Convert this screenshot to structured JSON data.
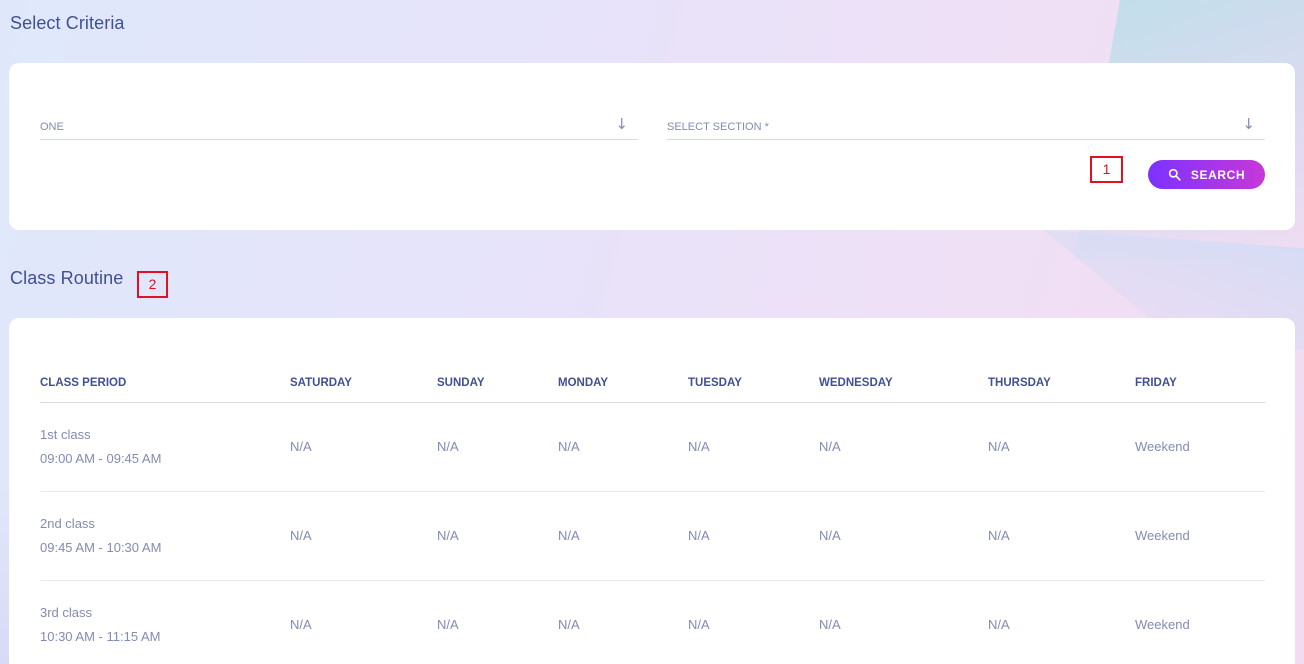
{
  "criteria": {
    "title": "Select Criteria",
    "class_select": {
      "value": "ONE",
      "icon": "arrow-down-icon"
    },
    "section_select": {
      "placeholder": "SELECT SECTION *",
      "icon": "arrow-down-icon"
    },
    "search_button": {
      "label": "SEARCH",
      "icon": "search-icon",
      "gradient": [
        "#7c32ff",
        "#c738d8"
      ]
    }
  },
  "markers": {
    "one": "1",
    "two": "2",
    "color": "#e0121f"
  },
  "routine": {
    "title": "Class Routine",
    "columns": [
      "CLASS PERIOD",
      "SATURDAY",
      "SUNDAY",
      "MONDAY",
      "TUESDAY",
      "WEDNESDAY",
      "THURSDAY",
      "FRIDAY"
    ],
    "rows": [
      {
        "period": "1st class",
        "time": "09:00 AM - 09:45 AM",
        "cells": [
          "N/A",
          "N/A",
          "N/A",
          "N/A",
          "N/A",
          "N/A",
          "Weekend"
        ]
      },
      {
        "period": "2nd class",
        "time": "09:45 AM - 10:30 AM",
        "cells": [
          "N/A",
          "N/A",
          "N/A",
          "N/A",
          "N/A",
          "N/A",
          "Weekend"
        ]
      },
      {
        "period": "3rd class",
        "time": "10:30 AM - 11:15 AM",
        "cells": [
          "N/A",
          "N/A",
          "N/A",
          "N/A",
          "N/A",
          "N/A",
          "Weekend"
        ]
      }
    ]
  },
  "colors": {
    "heading": "#415094",
    "muted": "#828bb2"
  }
}
